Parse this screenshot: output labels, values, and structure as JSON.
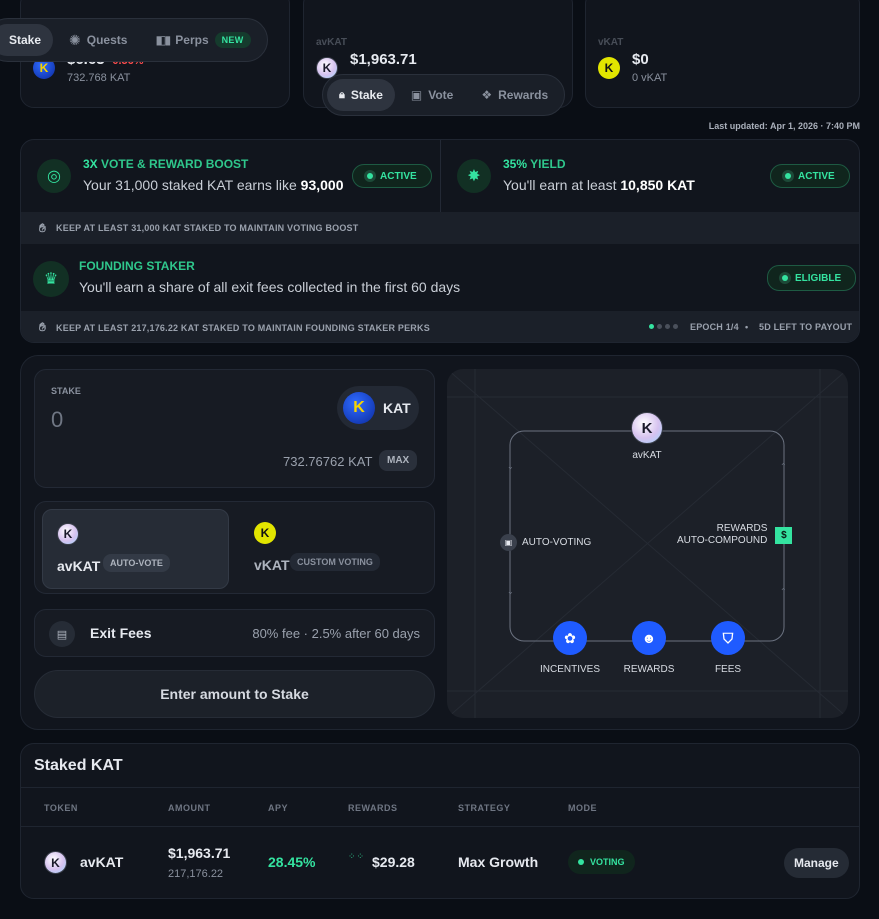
{
  "top_cards": {
    "kat": {
      "price": "$6.63",
      "change": "-0.56%",
      "balance": "732.768 KAT"
    },
    "avkat": {
      "label": "avKAT",
      "value": "$1,963.71"
    },
    "vkat": {
      "label": "vKAT",
      "value": "$0",
      "balance": "0 vKAT"
    }
  },
  "main_nav": [
    {
      "label": "Stake",
      "icon": "stake"
    },
    {
      "label": "Quests",
      "icon": "gear-icon"
    },
    {
      "label": "Perps",
      "icon": "bars-icon",
      "badge": "NEW"
    }
  ],
  "sub_nav": [
    {
      "label": "Stake",
      "icon": "lock-icon"
    },
    {
      "label": "Vote",
      "icon": "ticket-icon"
    },
    {
      "label": "Rewards",
      "icon": "gift-icon"
    }
  ],
  "last_updated": "Last updated: Apr 1, 2026 · 7:40 PM",
  "boost": {
    "title_highlight": "3X",
    "title_rest": " VOTE & REWARD BOOST",
    "desc_prefix": "Your 31,000 staked KAT earns like ",
    "desc_value": "93,000",
    "status": "ACTIVE"
  },
  "yield": {
    "title_highlight": "35%",
    "title_rest": " YIELD",
    "desc_prefix": "You'll earn at least ",
    "desc_value": "10,850 KAT",
    "status": "ACTIVE"
  },
  "boost_strip": "KEEP AT LEAST 31,000 KAT STAKED TO MAINTAIN VOTING BOOST",
  "founding": {
    "title": "FOUNDING STAKER",
    "desc": "You'll earn a share of all exit fees collected in the first 60 days",
    "status": "ELIGIBLE"
  },
  "founding_strip": {
    "text": "KEEP AT LEAST 217,176.22 KAT STAKED TO MAINTAIN FOUNDING STAKER PERKS",
    "epoch": "EPOCH 1/4",
    "payout": "5D LEFT TO PAYOUT"
  },
  "stake_form": {
    "label": "STAKE",
    "amount": "0",
    "token": "KAT",
    "balance": "732.76762 KAT",
    "max": "MAX"
  },
  "options": {
    "avkat": {
      "name": "avKAT",
      "tag": "AUTO-VOTE"
    },
    "vkat": {
      "name": "vKAT",
      "tag": "CUSTOM VOTING"
    }
  },
  "exit_fees": {
    "label": "Exit Fees",
    "value": "80% fee · 2.5% after 60 days"
  },
  "submit_label": "Enter amount to Stake",
  "flow": {
    "top": "avKAT",
    "left": "AUTO-VOTING",
    "right_1": "REWARDS",
    "right_2": "AUTO-COMPOUND",
    "right_icon": "$",
    "nodes": [
      "INCENTIVES",
      "REWARDS",
      "FEES"
    ]
  },
  "staked": {
    "title": "Staked KAT",
    "headers": [
      "TOKEN",
      "AMOUNT",
      "APY",
      "REWARDS",
      "STRATEGY",
      "MODE"
    ],
    "row": {
      "token": "avKAT",
      "amount_usd": "$1,963.71",
      "amount_kat": "217,176.22",
      "apy": "28.45%",
      "rewards": "$29.28",
      "strategy": "Max Growth",
      "mode": "VOTING",
      "action": "Manage"
    }
  }
}
